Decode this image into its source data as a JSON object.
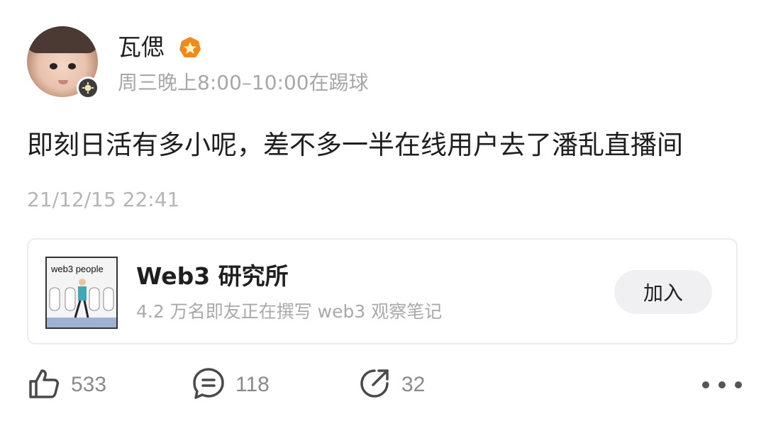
{
  "post": {
    "author": {
      "name": "瓦偲",
      "signature": "周三晚上8:00–10:00在踢球",
      "avatar_icon": "baby-photo-avatar",
      "badge_icon": "member-badge-icon",
      "verified_icon": "verified-badge-icon",
      "verified_color": "#f08a1c"
    },
    "text": "即刻日活有多小呢，差不多一半在线用户去了潘乱直播间",
    "timestamp": "21/12/15 22:41"
  },
  "circle_card": {
    "thumbnail_label": "web3 people",
    "title": "Web3 研究所",
    "subtitle": "4.2 万名即友正在撰写 web3 观察笔记",
    "join_label": "加入"
  },
  "actions": {
    "like_count": "533",
    "comment_count": "118",
    "share_count": "32",
    "like_icon": "thumbs-up-icon",
    "comment_icon": "comment-bubble-icon",
    "share_icon": "share-arrow-icon",
    "more_icon": "more-dots-icon"
  }
}
